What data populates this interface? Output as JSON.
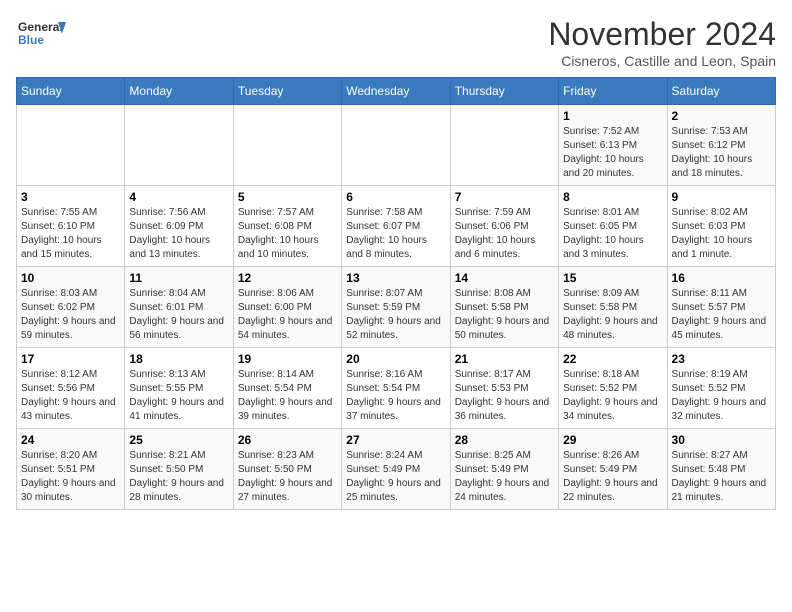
{
  "header": {
    "logo_line1": "General",
    "logo_line2": "Blue",
    "month": "November 2024",
    "location": "Cisneros, Castille and Leon, Spain"
  },
  "weekdays": [
    "Sunday",
    "Monday",
    "Tuesday",
    "Wednesday",
    "Thursday",
    "Friday",
    "Saturday"
  ],
  "weeks": [
    [
      {
        "day": "",
        "info": ""
      },
      {
        "day": "",
        "info": ""
      },
      {
        "day": "",
        "info": ""
      },
      {
        "day": "",
        "info": ""
      },
      {
        "day": "",
        "info": ""
      },
      {
        "day": "1",
        "info": "Sunrise: 7:52 AM\nSunset: 6:13 PM\nDaylight: 10 hours and 20 minutes."
      },
      {
        "day": "2",
        "info": "Sunrise: 7:53 AM\nSunset: 6:12 PM\nDaylight: 10 hours and 18 minutes."
      }
    ],
    [
      {
        "day": "3",
        "info": "Sunrise: 7:55 AM\nSunset: 6:10 PM\nDaylight: 10 hours and 15 minutes."
      },
      {
        "day": "4",
        "info": "Sunrise: 7:56 AM\nSunset: 6:09 PM\nDaylight: 10 hours and 13 minutes."
      },
      {
        "day": "5",
        "info": "Sunrise: 7:57 AM\nSunset: 6:08 PM\nDaylight: 10 hours and 10 minutes."
      },
      {
        "day": "6",
        "info": "Sunrise: 7:58 AM\nSunset: 6:07 PM\nDaylight: 10 hours and 8 minutes."
      },
      {
        "day": "7",
        "info": "Sunrise: 7:59 AM\nSunset: 6:06 PM\nDaylight: 10 hours and 6 minutes."
      },
      {
        "day": "8",
        "info": "Sunrise: 8:01 AM\nSunset: 6:05 PM\nDaylight: 10 hours and 3 minutes."
      },
      {
        "day": "9",
        "info": "Sunrise: 8:02 AM\nSunset: 6:03 PM\nDaylight: 10 hours and 1 minute."
      }
    ],
    [
      {
        "day": "10",
        "info": "Sunrise: 8:03 AM\nSunset: 6:02 PM\nDaylight: 9 hours and 59 minutes."
      },
      {
        "day": "11",
        "info": "Sunrise: 8:04 AM\nSunset: 6:01 PM\nDaylight: 9 hours and 56 minutes."
      },
      {
        "day": "12",
        "info": "Sunrise: 8:06 AM\nSunset: 6:00 PM\nDaylight: 9 hours and 54 minutes."
      },
      {
        "day": "13",
        "info": "Sunrise: 8:07 AM\nSunset: 5:59 PM\nDaylight: 9 hours and 52 minutes."
      },
      {
        "day": "14",
        "info": "Sunrise: 8:08 AM\nSunset: 5:58 PM\nDaylight: 9 hours and 50 minutes."
      },
      {
        "day": "15",
        "info": "Sunrise: 8:09 AM\nSunset: 5:58 PM\nDaylight: 9 hours and 48 minutes."
      },
      {
        "day": "16",
        "info": "Sunrise: 8:11 AM\nSunset: 5:57 PM\nDaylight: 9 hours and 45 minutes."
      }
    ],
    [
      {
        "day": "17",
        "info": "Sunrise: 8:12 AM\nSunset: 5:56 PM\nDaylight: 9 hours and 43 minutes."
      },
      {
        "day": "18",
        "info": "Sunrise: 8:13 AM\nSunset: 5:55 PM\nDaylight: 9 hours and 41 minutes."
      },
      {
        "day": "19",
        "info": "Sunrise: 8:14 AM\nSunset: 5:54 PM\nDaylight: 9 hours and 39 minutes."
      },
      {
        "day": "20",
        "info": "Sunrise: 8:16 AM\nSunset: 5:54 PM\nDaylight: 9 hours and 37 minutes."
      },
      {
        "day": "21",
        "info": "Sunrise: 8:17 AM\nSunset: 5:53 PM\nDaylight: 9 hours and 36 minutes."
      },
      {
        "day": "22",
        "info": "Sunrise: 8:18 AM\nSunset: 5:52 PM\nDaylight: 9 hours and 34 minutes."
      },
      {
        "day": "23",
        "info": "Sunrise: 8:19 AM\nSunset: 5:52 PM\nDaylight: 9 hours and 32 minutes."
      }
    ],
    [
      {
        "day": "24",
        "info": "Sunrise: 8:20 AM\nSunset: 5:51 PM\nDaylight: 9 hours and 30 minutes."
      },
      {
        "day": "25",
        "info": "Sunrise: 8:21 AM\nSunset: 5:50 PM\nDaylight: 9 hours and 28 minutes."
      },
      {
        "day": "26",
        "info": "Sunrise: 8:23 AM\nSunset: 5:50 PM\nDaylight: 9 hours and 27 minutes."
      },
      {
        "day": "27",
        "info": "Sunrise: 8:24 AM\nSunset: 5:49 PM\nDaylight: 9 hours and 25 minutes."
      },
      {
        "day": "28",
        "info": "Sunrise: 8:25 AM\nSunset: 5:49 PM\nDaylight: 9 hours and 24 minutes."
      },
      {
        "day": "29",
        "info": "Sunrise: 8:26 AM\nSunset: 5:49 PM\nDaylight: 9 hours and 22 minutes."
      },
      {
        "day": "30",
        "info": "Sunrise: 8:27 AM\nSunset: 5:48 PM\nDaylight: 9 hours and 21 minutes."
      }
    ]
  ]
}
